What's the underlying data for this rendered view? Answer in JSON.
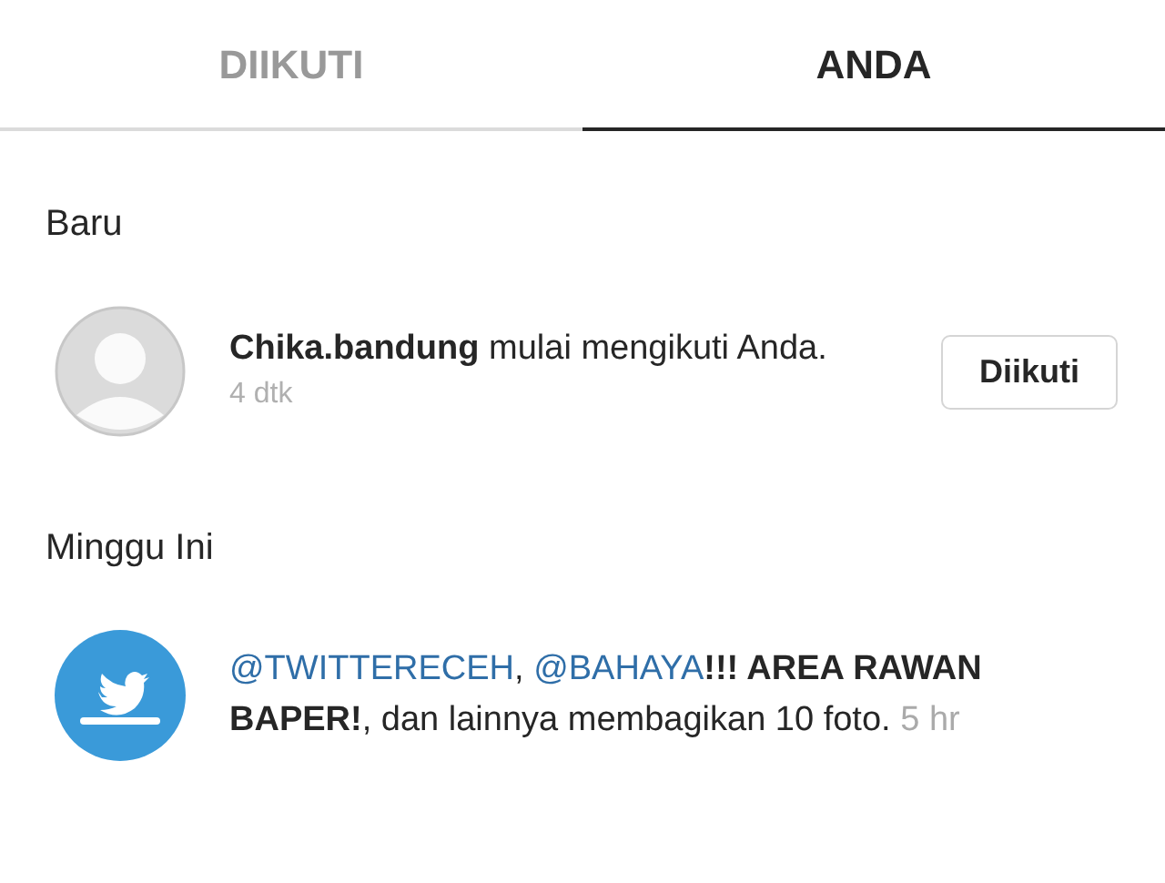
{
  "tabs": [
    {
      "label": "DIIKUTI",
      "selected": false
    },
    {
      "label": "ANDA",
      "selected": true
    }
  ],
  "sections": [
    {
      "heading": "Baru",
      "items": [
        {
          "avatar": {
            "kind": "person"
          },
          "segments": [
            {
              "kind": "bold",
              "text": "Chika.bandung"
            },
            {
              "kind": "text",
              "text": " mulai mengikuti Anda."
            }
          ],
          "time": "4 dtk",
          "button": "Diikuti"
        }
      ]
    },
    {
      "heading": "Minggu Ini",
      "items": [
        {
          "avatar": {
            "kind": "bird"
          },
          "segments": [
            {
              "kind": "mention",
              "text": "@TWITTERECEH"
            },
            {
              "kind": "text",
              "text": ", "
            },
            {
              "kind": "mention",
              "text": "@BAHAYA"
            },
            {
              "kind": "bold",
              "text": "!!! AREA RAWAN BAPER!"
            },
            {
              "kind": "text",
              "text": ", dan lainnya membagikan 10 foto."
            }
          ],
          "time": "5 hr"
        }
      ]
    }
  ]
}
